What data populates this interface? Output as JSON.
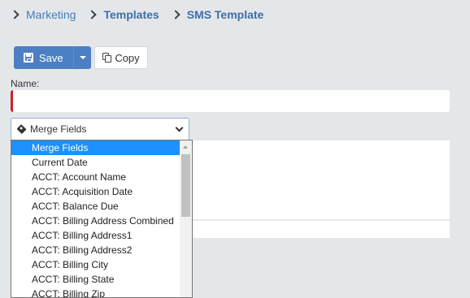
{
  "breadcrumb": {
    "items": [
      {
        "label": "Marketing",
        "style": "link"
      },
      {
        "label": "Templates",
        "style": "bold"
      },
      {
        "label": "SMS Template",
        "style": "bold"
      }
    ]
  },
  "toolbar": {
    "save_label": "Save",
    "copy_label": "Copy"
  },
  "form": {
    "name_label": "Name:",
    "name_value": "",
    "required": true
  },
  "merge_fields": {
    "selected": "Merge Fields",
    "options": [
      "Merge Fields",
      "Current Date",
      "ACCT: Account Name",
      "ACCT: Acquisition Date",
      "ACCT: Balance Due",
      "ACCT: Billing Address Combined",
      "ACCT: Billing Address1",
      "ACCT: Billing Address2",
      "ACCT: Billing City",
      "ACCT: Billing State",
      "ACCT: Billing Zip"
    ],
    "highlighted_index": 0
  },
  "colors": {
    "primary": "#4d7fc4",
    "required": "#d0202a",
    "highlight": "#1e90ff",
    "background": "#e4e7ea"
  }
}
